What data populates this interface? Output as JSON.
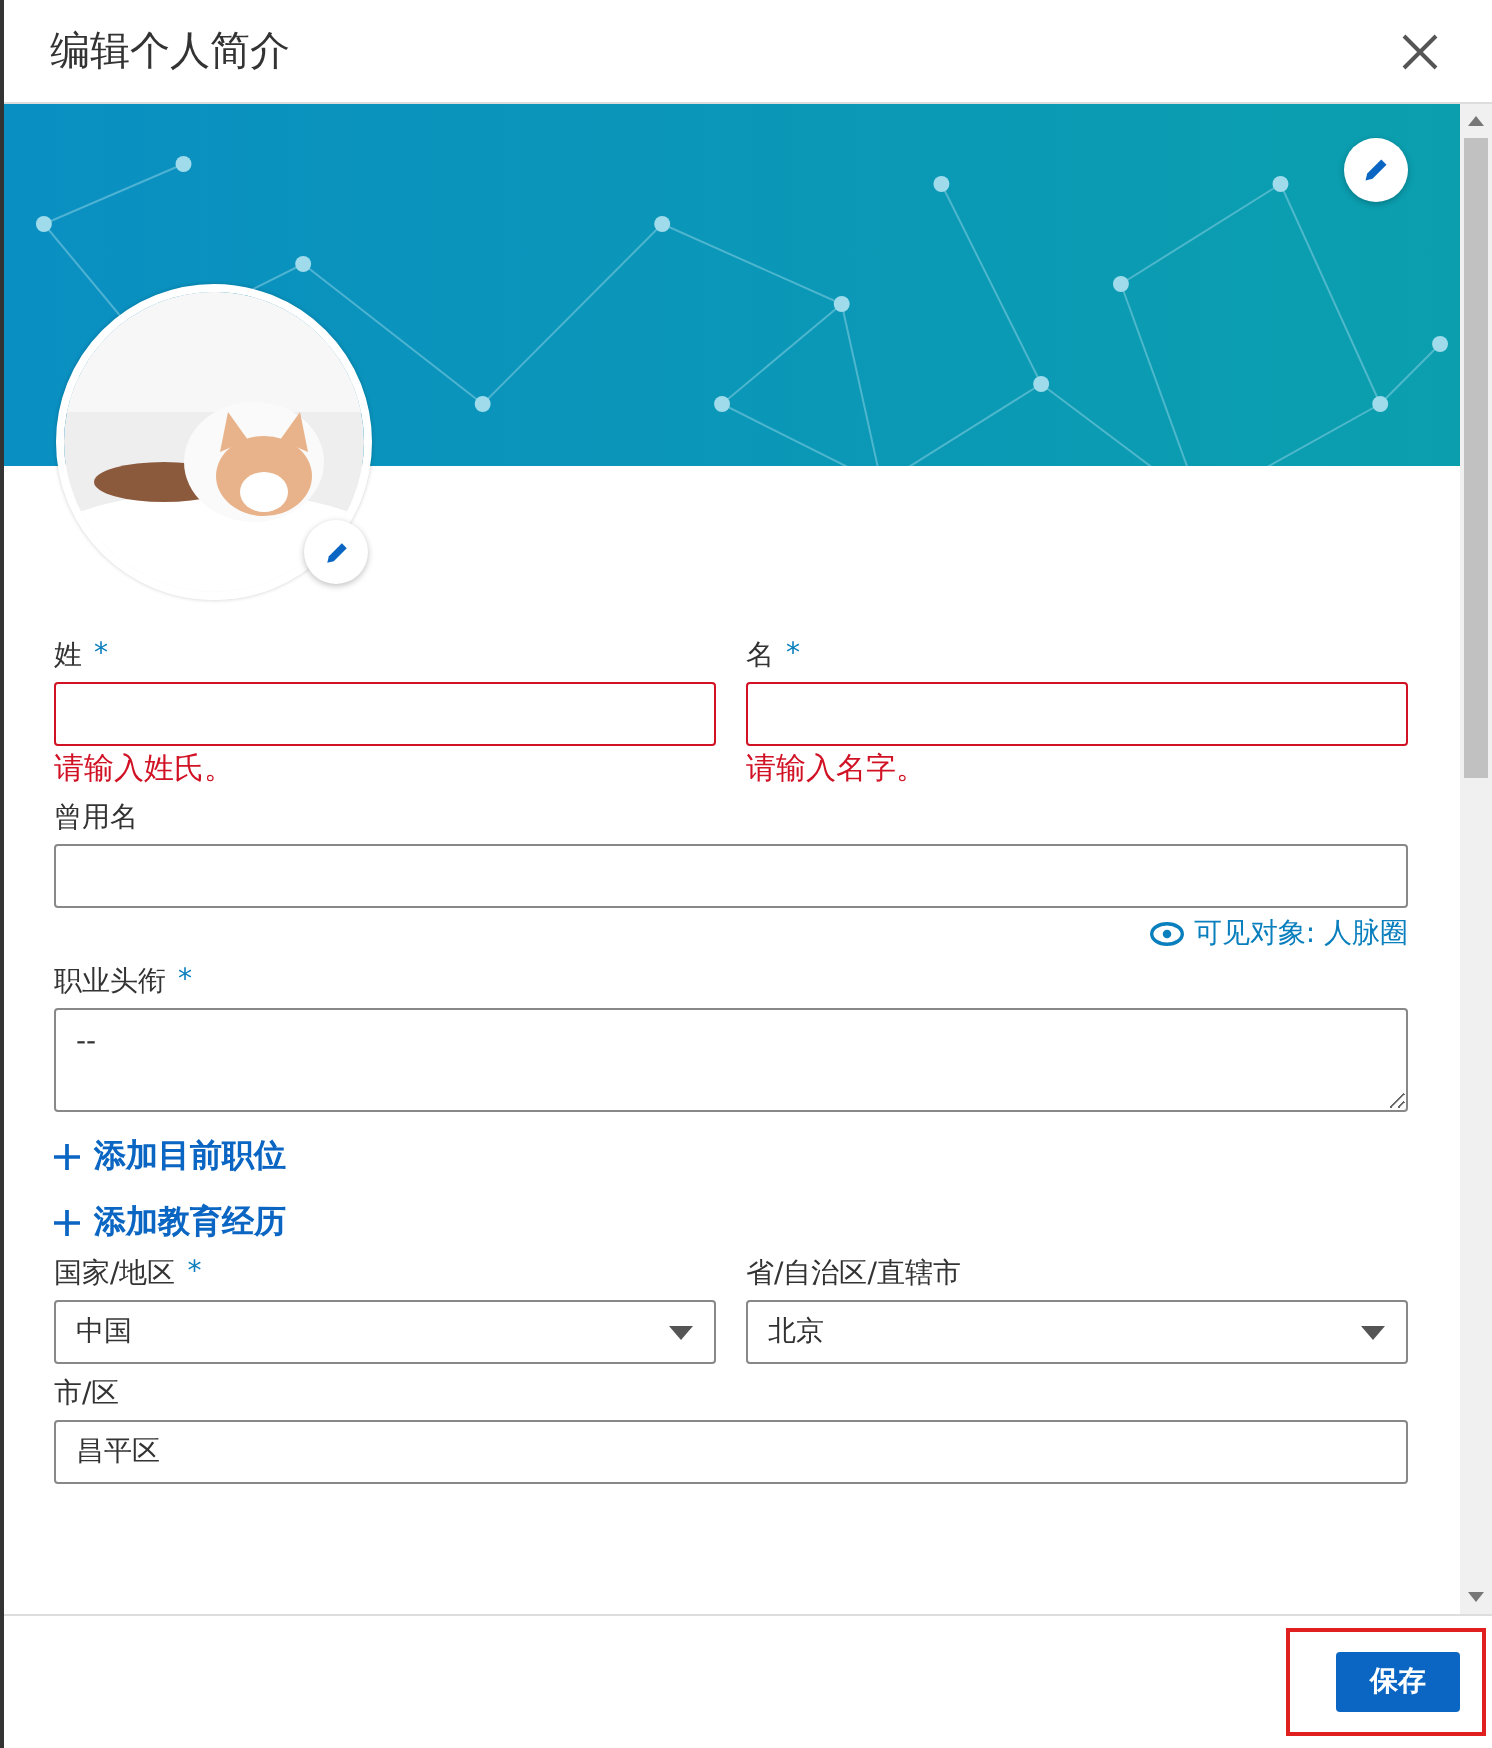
{
  "dialog": {
    "title": "编辑个人简介"
  },
  "form": {
    "items": [
      {
        "kind": "row",
        "fields": [
          {
            "kind": "input",
            "label": "姓",
            "required_mark": "*",
            "invalid": true,
            "error": "请输入姓氏。"
          },
          {
            "kind": "input",
            "label": "名",
            "required_mark": "*",
            "invalid": true,
            "error": "请输入名字。"
          }
        ]
      },
      {
        "kind": "row",
        "fields": [
          {
            "kind": "input",
            "label": "曾用名",
            "invalid": false
          }
        ]
      },
      {
        "kind": "visibility",
        "text": "可见对象: 人脉圈"
      },
      {
        "kind": "row",
        "fields": [
          {
            "kind": "textarea",
            "label": "职业头衔",
            "required_mark": "*",
            "value": "--",
            "invalid": false
          }
        ]
      },
      {
        "kind": "add_link",
        "text": "添加目前职位"
      },
      {
        "kind": "add_link",
        "text": "添加教育经历"
      },
      {
        "kind": "row",
        "fields": [
          {
            "kind": "select",
            "label": "国家/地区",
            "required_mark": "*",
            "value": "中国",
            "invalid": false
          },
          {
            "kind": "select",
            "label": "省/自治区/直辖市",
            "value": "北京",
            "invalid": false
          }
        ]
      },
      {
        "kind": "row",
        "fields": [
          {
            "kind": "input",
            "label": "市/区",
            "value": "昌平区",
            "invalid": false
          }
        ]
      }
    ]
  },
  "footer": {
    "save": "保存"
  }
}
